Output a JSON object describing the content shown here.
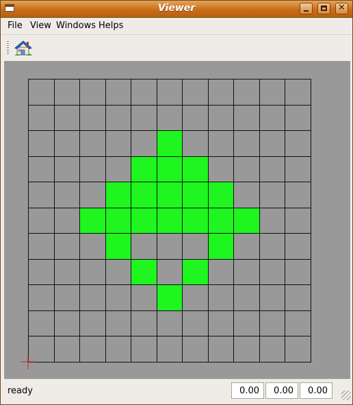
{
  "window": {
    "title": "Viewer"
  },
  "menubar": {
    "items": [
      "File",
      "View",
      "Windows",
      "Helps"
    ]
  },
  "toolbar": {
    "home_icon": "home-icon"
  },
  "colors": {
    "canvas_bg": "#999999",
    "cell_on": "#1ff51f",
    "grid_line": "#111111",
    "title_bar": "#c96d18"
  },
  "grid": {
    "rows": 11,
    "cols": 11,
    "cells": [
      [
        0,
        0,
        0,
        0,
        0,
        0,
        0,
        0,
        0,
        0,
        0
      ],
      [
        0,
        0,
        0,
        0,
        0,
        0,
        0,
        0,
        0,
        0,
        0
      ],
      [
        0,
        0,
        0,
        0,
        0,
        1,
        0,
        0,
        0,
        0,
        0
      ],
      [
        0,
        0,
        0,
        0,
        1,
        1,
        1,
        0,
        0,
        0,
        0
      ],
      [
        0,
        0,
        0,
        1,
        1,
        1,
        1,
        1,
        0,
        0,
        0
      ],
      [
        0,
        0,
        1,
        1,
        1,
        1,
        1,
        1,
        1,
        0,
        0
      ],
      [
        0,
        0,
        0,
        1,
        0,
        0,
        0,
        1,
        0,
        0,
        0
      ],
      [
        0,
        0,
        0,
        0,
        1,
        0,
        1,
        0,
        0,
        0,
        0
      ],
      [
        0,
        0,
        0,
        0,
        0,
        1,
        0,
        0,
        0,
        0,
        0
      ],
      [
        0,
        0,
        0,
        0,
        0,
        0,
        0,
        0,
        0,
        0,
        0
      ],
      [
        0,
        0,
        0,
        0,
        0,
        0,
        0,
        0,
        0,
        0,
        0
      ]
    ]
  },
  "status": {
    "text": "ready",
    "coords": [
      "0.00",
      "0.00",
      "0.00"
    ]
  }
}
